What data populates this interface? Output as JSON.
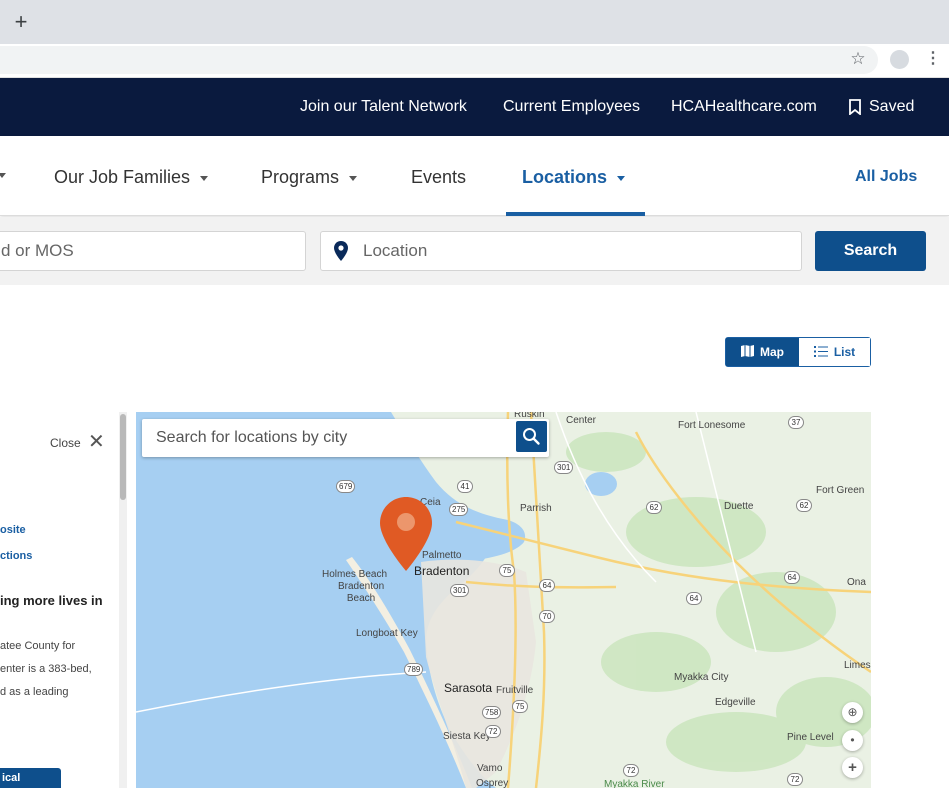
{
  "browser": {
    "new_tab_symbol": "+",
    "bookmark_icon": "star-icon",
    "menu_icon": "more-vert-icon"
  },
  "utility_nav": {
    "links": [
      "Join our Talent Network",
      "Current Employees",
      "HCAHealthcare.com"
    ],
    "saved_label": "Saved"
  },
  "main_nav": {
    "items": [
      {
        "label": "Our Job Families",
        "has_dropdown": true
      },
      {
        "label": "Programs",
        "has_dropdown": true
      },
      {
        "label": "Events",
        "has_dropdown": false
      },
      {
        "label": "Locations",
        "has_dropdown": true,
        "active": true
      }
    ],
    "all_jobs_label": "All Jobs"
  },
  "search": {
    "keyword_placeholder": "d or MOS",
    "location_placeholder": "Location",
    "button_label": "Search"
  },
  "view_toggle": {
    "map_label": "Map",
    "list_label": "List",
    "selected": "Map"
  },
  "side_panel": {
    "close_label": "Close",
    "links": [
      "osite",
      "ctions"
    ],
    "heading": "ing more lives in",
    "body_lines": [
      "atee County for",
      "enter is a 383-bed,",
      "d as a leading"
    ],
    "button_label": "ical"
  },
  "map": {
    "search_placeholder": "Search for locations by city",
    "places": {
      "ruskin": "Ruskin",
      "center": "Center",
      "fort_lonesome": "Fort Lonesome",
      "fort_green": "Fort Green",
      "duette": "Duette",
      "parrish": "Parrish",
      "palmetto": "Palmetto",
      "bradenton": "Bradenton",
      "holmes_beach": "Holmes Beach",
      "bradenton_beach": "Bradenton\nBeach",
      "ona": "Ona",
      "longboat_key": "Longboat Key",
      "sarasota": "Sarasota",
      "fruitville": "Fruitville",
      "myakka_city": "Myakka City",
      "edgeville": "Edgeville",
      "limes": "Limes",
      "siesta_key": "Siesta Key",
      "pine_level": "Pine Level",
      "vamo": "Vamo",
      "osprey": "Osprey",
      "myakka_river": "Myakka River",
      "ceia": "Ceia"
    },
    "route_shields": [
      "37",
      "301",
      "41",
      "275",
      "679",
      "62",
      "62",
      "75",
      "64",
      "301",
      "70",
      "64",
      "64",
      "789",
      "758",
      "75",
      "72",
      "72",
      "72"
    ],
    "controls": [
      "globe-icon",
      "my-location-icon",
      "zoom-in-icon"
    ],
    "zoom_in_symbol": "+"
  },
  "colors": {
    "utility_bar": "#0a1a3e",
    "brand_blue": "#1a5fa3",
    "button_blue": "#0e4f8c",
    "marker": "#e05a24",
    "water": "#a6cff2",
    "land": "#eaf1e4"
  }
}
